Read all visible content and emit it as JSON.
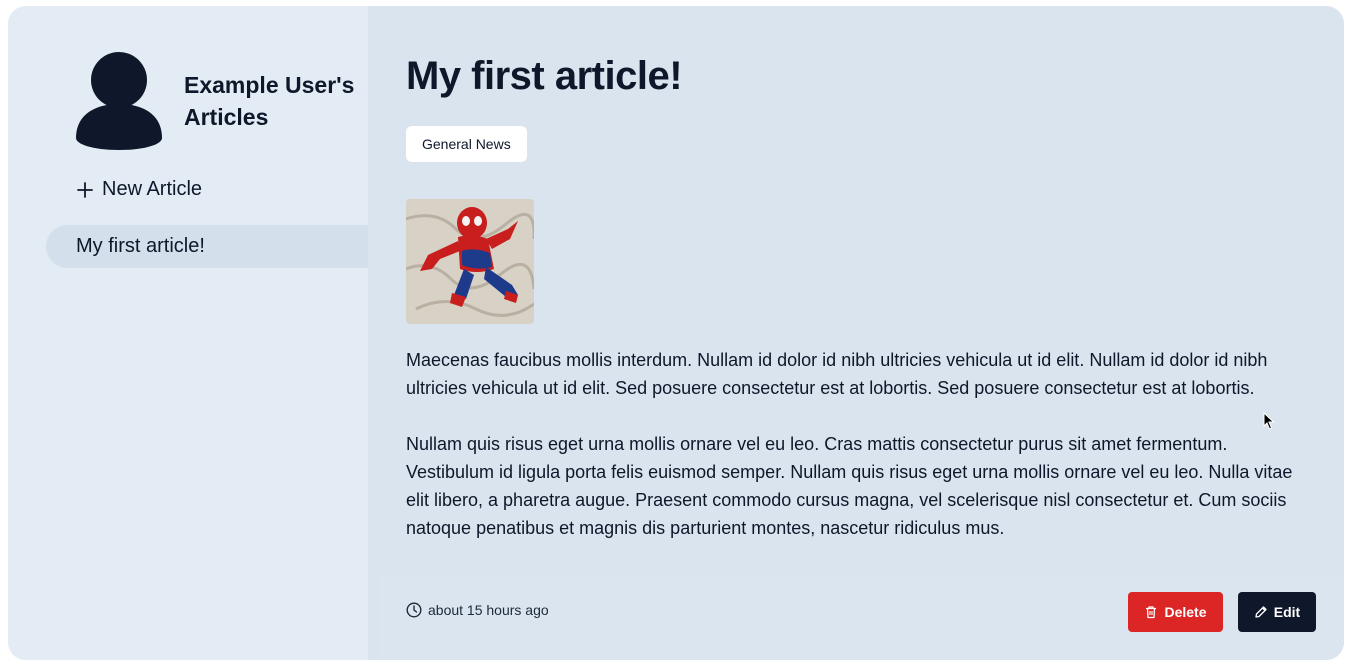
{
  "sidebar": {
    "profile_name": "Example User's Articles",
    "new_article_label": "New Article",
    "items": [
      {
        "label": "My first article!"
      }
    ]
  },
  "article": {
    "title": "My first article!",
    "tag": "General News",
    "paragraphs": [
      "Maecenas faucibus mollis interdum. Nullam id dolor id nibh ultricies vehicula ut id elit. Nullam id dolor id nibh ultricies vehicula ut id elit. Sed posuere consectetur est at lobortis. Sed posuere consectetur est at lobortis.",
      "Nullam quis risus eget urna mollis ornare vel eu leo. Cras mattis consectetur purus sit amet fermentum. Vestibulum id ligula porta felis euismod semper. Nullam quis risus eget urna mollis ornare vel eu leo. Nulla vitae elit libero, a pharetra augue. Praesent commodo cursus magna, vel scelerisque nisl consectetur et. Cum sociis natoque penatibus et magnis dis parturient montes, nascetur ridiculus mus."
    ],
    "timestamp": "about 15 hours ago"
  },
  "actions": {
    "delete_label": "Delete",
    "edit_label": "Edit"
  },
  "icons": {
    "avatar": "user-silhouette-icon",
    "new_article": "plus-icon",
    "timestamp": "clock-icon",
    "delete": "trash-icon",
    "edit": "pencil-icon"
  },
  "colors": {
    "delete_button": "#dc2626",
    "edit_button": "#0f172a",
    "sidebar_bg": "#e3ebf4",
    "main_bg": "#d9e4ee"
  }
}
